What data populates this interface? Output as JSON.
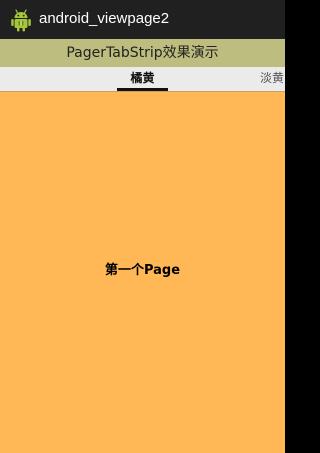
{
  "app": {
    "title": "android_viewpage2",
    "icon": "android-robot-icon"
  },
  "header": {
    "title": "PagerTabStrip效果演示"
  },
  "tabstrip": {
    "current_tab": "橘黄",
    "next_tab": "淡黄"
  },
  "page": {
    "label": "第一个Page"
  },
  "colors": {
    "titlebar": "#202020",
    "header": "#BDBD7F",
    "tabstrip": "#EBEBEB",
    "page_background": "#FFB855",
    "indicator": "#111111"
  }
}
